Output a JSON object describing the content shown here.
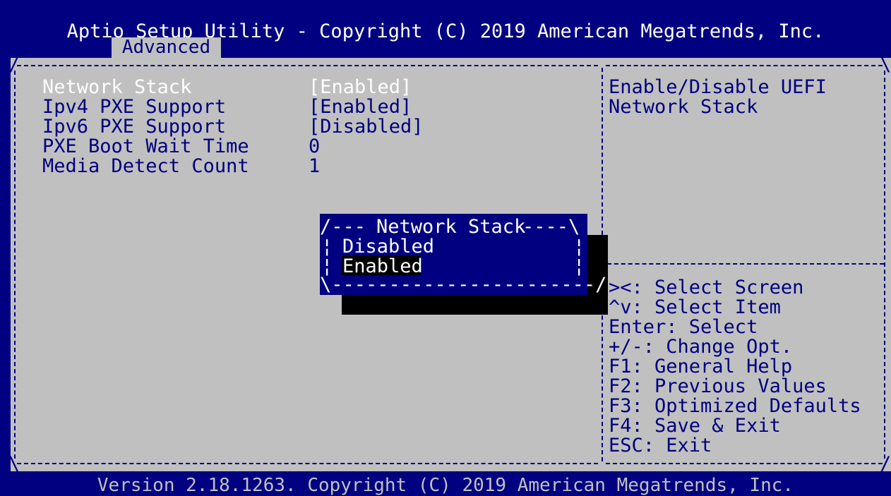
{
  "header": {
    "title": "Aptio Setup Utility - Copyright (C) 2019 American Megatrends, Inc.",
    "active_tab": "Advanced"
  },
  "settings": [
    {
      "label": "Network Stack",
      "value": "[Enabled]",
      "highlighted": true
    },
    {
      "label": "Ipv4 PXE Support",
      "value": "[Enabled]",
      "highlighted": false
    },
    {
      "label": "Ipv6 PXE Support",
      "value": "[Disabled]",
      "highlighted": false
    },
    {
      "label": "PXE Boot Wait Time",
      "value": "0",
      "highlighted": false
    },
    {
      "label": "Media Detect Count",
      "value": "1",
      "highlighted": false
    }
  ],
  "help_text": [
    "Enable/Disable UEFI",
    "Network Stack"
  ],
  "key_help": [
    "><: Select Screen",
    "^v: Select Item",
    "Enter: Select",
    "+/-: Change Opt.",
    "F1: General Help",
    "F2: Previous Values",
    "F3: Optimized Defaults",
    "F4: Save & Exit",
    "ESC: Exit"
  ],
  "popup": {
    "title": "Network Stack",
    "options": [
      "Disabled",
      "Enabled"
    ],
    "selected_index": 1
  },
  "footer": "Version 2.18.1263. Copyright (C) 2019 American Megatrends, Inc.",
  "colors": {
    "background_blue": "#000080",
    "panel_grey": "#c0c0c0",
    "highlight_white": "#ffffff",
    "shadow_black": "#000000"
  }
}
